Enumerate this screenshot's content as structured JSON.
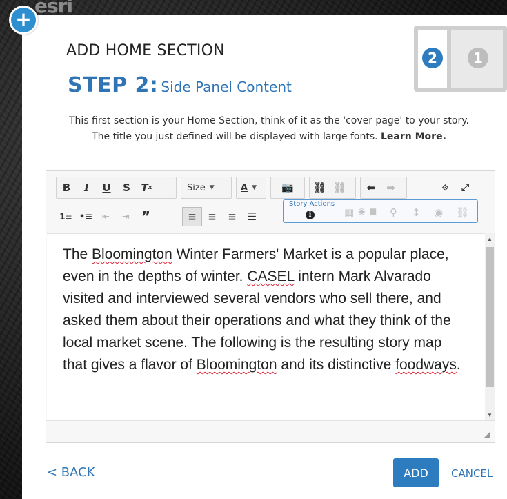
{
  "background": {
    "logo_text": "esri"
  },
  "dialog": {
    "title": "ADD HOME SECTION",
    "step_label": "STEP 2:",
    "step_name": "Side Panel Content",
    "layout_badges": [
      "2",
      "1"
    ],
    "intro_line1": "This first section is your Home Section, think of it as the 'cover page' to your story.",
    "intro_line2": "The title you just defined will be displayed with large fonts.",
    "learn_more": "Learn More.",
    "toolbar": {
      "size_label": "Size",
      "story_actions_label": "Story Actions"
    },
    "content_parts": {
      "p1": "The ",
      "w1": "Bloomington",
      "p2": " Winter Farmers' Market is a popular place, even in the depths of winter. ",
      "w2": "CASEL",
      "p3": " intern Mark Alvarado visited and interviewed several vendors who sell there, and asked them about their operations and what they think of the local market scene. The following is the resulting story map that gives a flavor of ",
      "w3": "Bloomington",
      "p4": " and its distinctive ",
      "w4": "foodways",
      "p5": "."
    },
    "buttons": {
      "back": "< BACK",
      "add": "ADD",
      "cancel": "CANCEL"
    }
  },
  "colors": {
    "accent": "#2d7cc0",
    "step_title": "#2f75b5"
  }
}
